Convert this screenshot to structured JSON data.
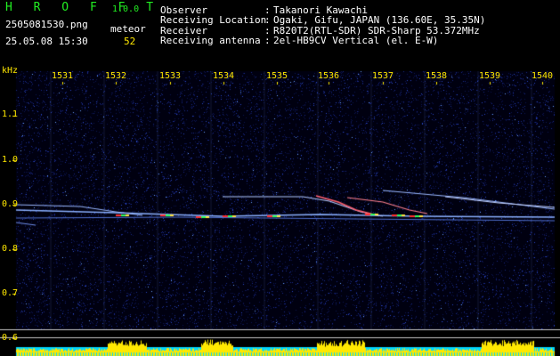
{
  "app": {
    "name": "H R O F F T",
    "version": "1.0.0"
  },
  "file": {
    "name": "2505081530.png",
    "datetime": "25.05.08 15:30"
  },
  "counter": {
    "label": "meteor",
    "value": "52"
  },
  "info": [
    {
      "key": "Observer",
      "sep": ":",
      "value": "Takanori Kawachi"
    },
    {
      "key": "Receiving Location",
      "sep": ":",
      "value": "Ogaki, Gifu, JAPAN (136.60E, 35.35N)"
    },
    {
      "key": "Receiver",
      "sep": ":",
      "value": "R820T2(RTL-SDR) SDR-Sharp 53.372MHz"
    },
    {
      "key": "Receiving antenna",
      "sep": ":",
      "value": "2el-HB9CV Vertical (el. E-W)"
    }
  ],
  "axes": {
    "y_unit": "kHz",
    "x_ticks": [
      "1531",
      "1532",
      "1533",
      "1534",
      "1535",
      "1536",
      "1537",
      "1538",
      "1539",
      "1540"
    ],
    "y_ticks": [
      "1.1",
      "1.0",
      "0.9",
      "0.8",
      "0.7",
      "0.6"
    ]
  },
  "colors": {
    "background": "#000000",
    "noise": "#1a2a8a",
    "carrier": "#8ab0ff",
    "meteor_hot": "#ff4040",
    "level_fill": "#ffe800",
    "level_base": "#00d8ff",
    "text_green": "#22ee22",
    "text_yellow": "#ffe800"
  }
}
